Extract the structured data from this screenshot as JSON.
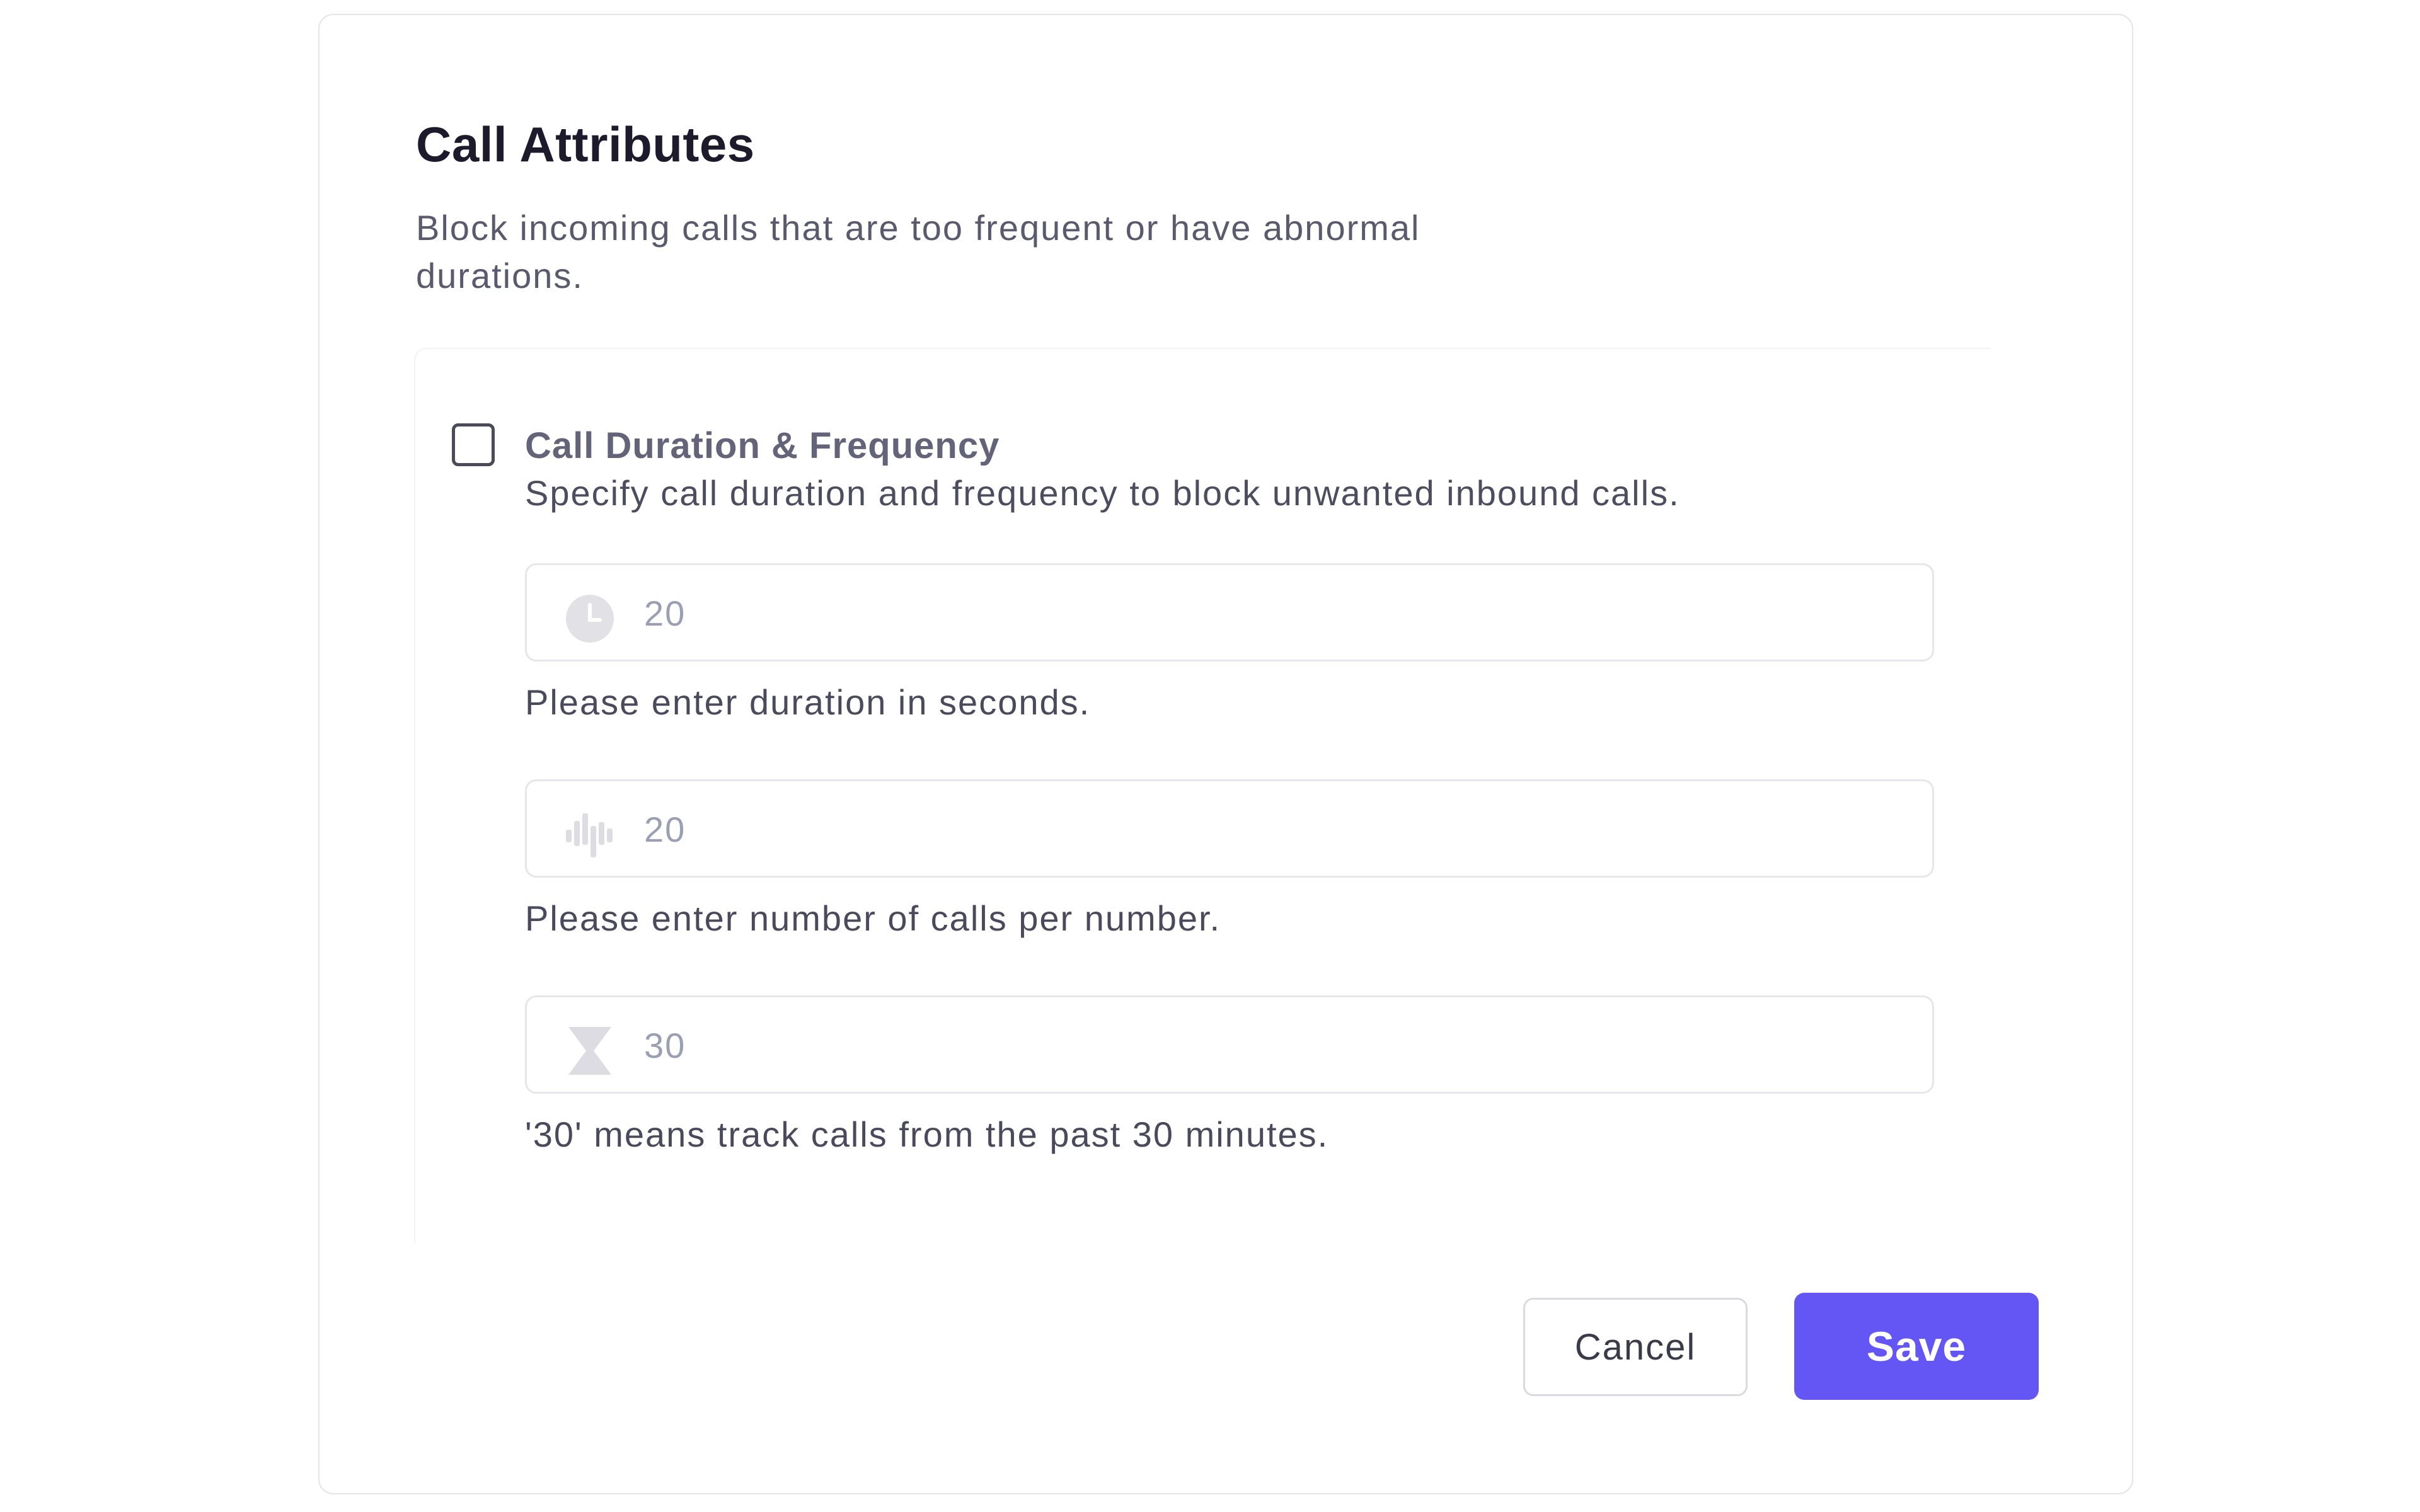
{
  "dialog": {
    "title": "Call Attributes",
    "subtitle": "Block incoming calls that are too frequent or have abnormal durations."
  },
  "option": {
    "checked": false,
    "title": "Call Duration & Frequency",
    "description": "Specify call duration and frequency to block unwanted inbound calls."
  },
  "fields": [
    {
      "icon": "clock-icon",
      "value": "20",
      "hint": "Please enter duration in seconds."
    },
    {
      "icon": "waveform-icon",
      "value": "20",
      "hint": "Please enter number of calls per number."
    },
    {
      "icon": "hourglass-icon",
      "value": "30",
      "hint": "'30' means track calls from the past 30 minutes."
    }
  ],
  "actions": {
    "cancel_label": "Cancel",
    "save_label": "Save"
  },
  "colors": {
    "accent": "#6356f5",
    "title_text": "#1c1a2b",
    "placeholder_text": "#9a9fb4"
  }
}
